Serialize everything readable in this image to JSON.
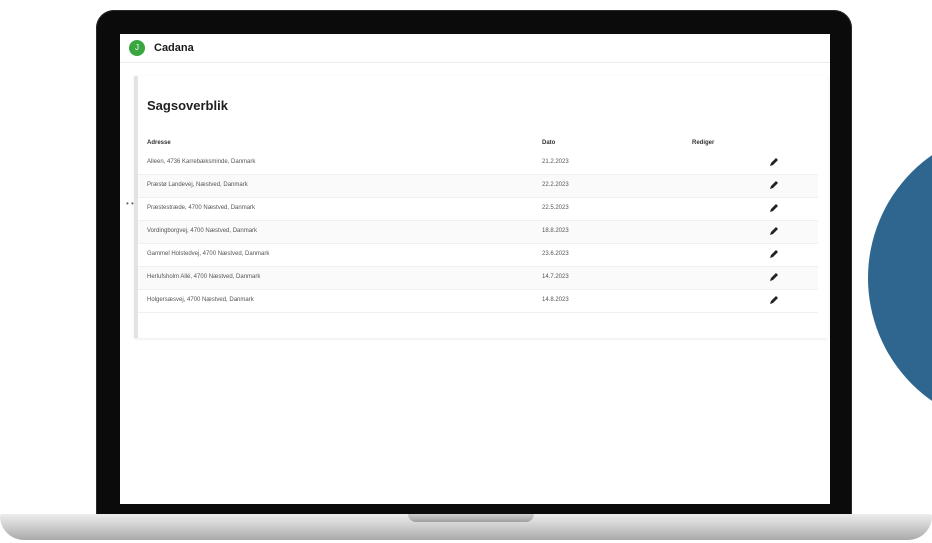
{
  "app": {
    "logo_text": "J",
    "title": "Cadana"
  },
  "page": {
    "title": "Sagsoverblik"
  },
  "table": {
    "headers": {
      "address": "Adresse",
      "date": "Dato",
      "edit": "Rediger"
    },
    "rows": [
      {
        "address": "Alleen, 4736 Karrebæksminde, Danmark",
        "date": "21.2.2023"
      },
      {
        "address": "Præstø Landevej, Næstved, Danmark",
        "date": "22.2.2023"
      },
      {
        "address": "Præstestræde, 4700 Næstved, Danmark",
        "date": "22.5.2023"
      },
      {
        "address": "Vordingborgvej, 4700 Næstved, Danmark",
        "date": "18.8.2023"
      },
      {
        "address": "Gammel Holstedvej, 4700 Næstved, Danmark",
        "date": "23.6.2023"
      },
      {
        "address": "Herlufsholm Allé, 4700 Næstved, Danmark",
        "date": "14.7.2023"
      },
      {
        "address": "Holgersæsvej, 4700 Næstved, Danmark",
        "date": "14.8.2023"
      }
    ]
  },
  "colors": {
    "brand_green": "#3aa640",
    "accent_blue": "#2e6690"
  },
  "icons": {
    "edit": "pencil-icon",
    "side": "ellipsis-icon"
  },
  "side_marker": "• •"
}
